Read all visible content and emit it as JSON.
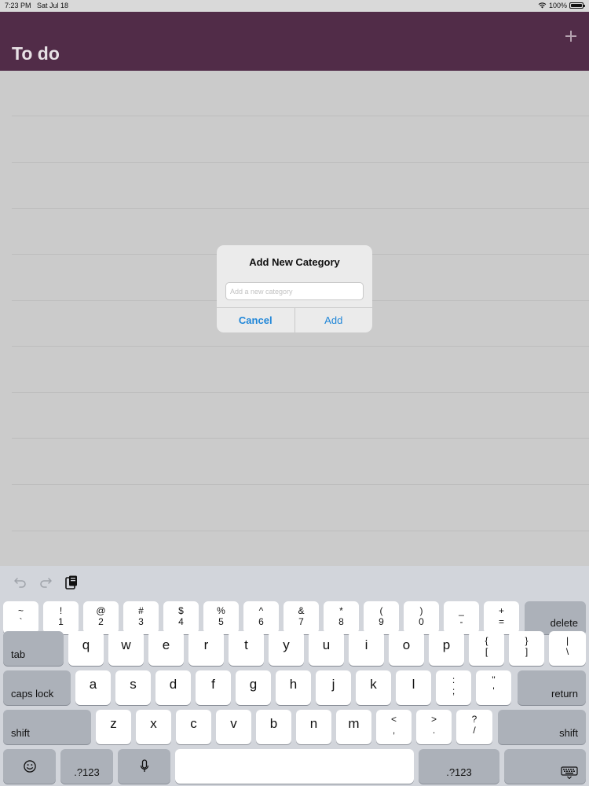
{
  "status_bar": {
    "time": "7:23 PM",
    "date": "Sat Jul 18",
    "battery": "100%"
  },
  "nav": {
    "title": "To do",
    "add_icon": "plus-icon"
  },
  "alert": {
    "title": "Add New Category",
    "input_placeholder": "Add a new category",
    "input_value": "",
    "cancel_label": "Cancel",
    "add_label": "Add"
  },
  "keyboard": {
    "toolbar": {
      "undo_icon": "undo-icon",
      "redo_icon": "redo-icon",
      "paste_icon": "paste-icon"
    },
    "row1": [
      {
        "top": "~",
        "bot": "`"
      },
      {
        "top": "!",
        "bot": "1"
      },
      {
        "top": "@",
        "bot": "2"
      },
      {
        "top": "#",
        "bot": "3"
      },
      {
        "top": "$",
        "bot": "4"
      },
      {
        "top": "%",
        "bot": "5"
      },
      {
        "top": "^",
        "bot": "6"
      },
      {
        "top": "&",
        "bot": "7"
      },
      {
        "top": "*",
        "bot": "8"
      },
      {
        "top": "(",
        "bot": "9"
      },
      {
        "top": ")",
        "bot": "0"
      },
      {
        "top": "_",
        "bot": "-"
      },
      {
        "top": "+",
        "bot": "="
      }
    ],
    "delete_label": "delete",
    "tab_label": "tab",
    "row2": [
      "q",
      "w",
      "e",
      "r",
      "t",
      "y",
      "u",
      "i",
      "o",
      "p"
    ],
    "row2_sym": [
      {
        "top": "{",
        "bot": "["
      },
      {
        "top": "}",
        "bot": "]"
      },
      {
        "top": "|",
        "bot": "\\"
      }
    ],
    "caps_label": "caps lock",
    "row3": [
      "a",
      "s",
      "d",
      "f",
      "g",
      "h",
      "j",
      "k",
      "l"
    ],
    "row3_sym": [
      {
        "top": ":",
        "bot": ";"
      },
      {
        "top": "\"",
        "bot": "'"
      }
    ],
    "return_label": "return",
    "shift_label": "shift",
    "row4": [
      "z",
      "x",
      "c",
      "v",
      "b",
      "n",
      "m"
    ],
    "row4_sym": [
      {
        "top": "<",
        "bot": ","
      },
      {
        "top": ">",
        "bot": "."
      },
      {
        "top": "?",
        "bot": "/"
      }
    ],
    "numeric_label": ".?123",
    "emoji_icon": "emoji-icon",
    "mic_icon": "microphone-icon",
    "dismiss_icon": "keyboard-dismiss-icon"
  }
}
